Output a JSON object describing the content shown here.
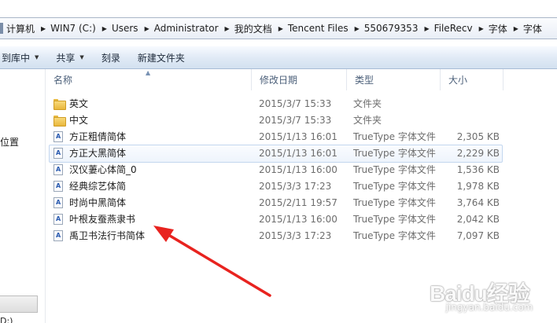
{
  "address": {
    "crumbs": [
      "计算机",
      "WIN7 (C:)",
      "Users",
      "Administrator",
      "我的文档",
      "Tencent Files",
      "550679353",
      "FileRecv",
      "字体",
      "字体"
    ]
  },
  "toolbar": {
    "include_label": "到库中",
    "share_label": "共享",
    "burn_label": "刻录",
    "new_folder_label": "新建文件夹"
  },
  "nav": {
    "location_label": "位置",
    "drive_label": "D:)"
  },
  "columns": {
    "name": "名称",
    "date": "修改日期",
    "type": "类型",
    "size": "大小"
  },
  "files": [
    {
      "name": "英文",
      "date": "2015/3/7 15:33",
      "type": "文件夹",
      "size": "",
      "icon": "folder"
    },
    {
      "name": "中文",
      "date": "2015/3/7 15:33",
      "type": "文件夹",
      "size": "",
      "icon": "folder"
    },
    {
      "name": "方正粗倩简体",
      "date": "2015/1/13 16:01",
      "type": "TrueType 字体文件",
      "size": "2,305 KB",
      "icon": "font"
    },
    {
      "name": "方正大黑简体",
      "date": "2015/1/13 16:01",
      "type": "TrueType 字体文件",
      "size": "2,229 KB",
      "icon": "font"
    },
    {
      "name": "汉仪萋心体简_0",
      "date": "2015/1/13 16:00",
      "type": "TrueType 字体文件",
      "size": "1,536 KB",
      "icon": "font"
    },
    {
      "name": "经典综艺体简",
      "date": "2015/3/3 17:23",
      "type": "TrueType 字体文件",
      "size": "1,978 KB",
      "icon": "font"
    },
    {
      "name": "时尚中黑简体",
      "date": "2015/2/11 19:57",
      "type": "TrueType 字体文件",
      "size": "3,764 KB",
      "icon": "font"
    },
    {
      "name": "叶根友蚕燕隶书",
      "date": "2015/1/13 16:00",
      "type": "TrueType 字体文件",
      "size": "2,042 KB",
      "icon": "font"
    },
    {
      "name": "禹卫书法行书简体",
      "date": "2015/3/3 17:23",
      "type": "TrueType 字体文件",
      "size": "7,097 KB",
      "icon": "font"
    }
  ],
  "watermark": {
    "logo": "Baidu经验",
    "url": "jingyan.baidu.com"
  },
  "colors": {
    "annotation_arrow": "#e8231f",
    "hover_border": "#c3d6ef"
  }
}
